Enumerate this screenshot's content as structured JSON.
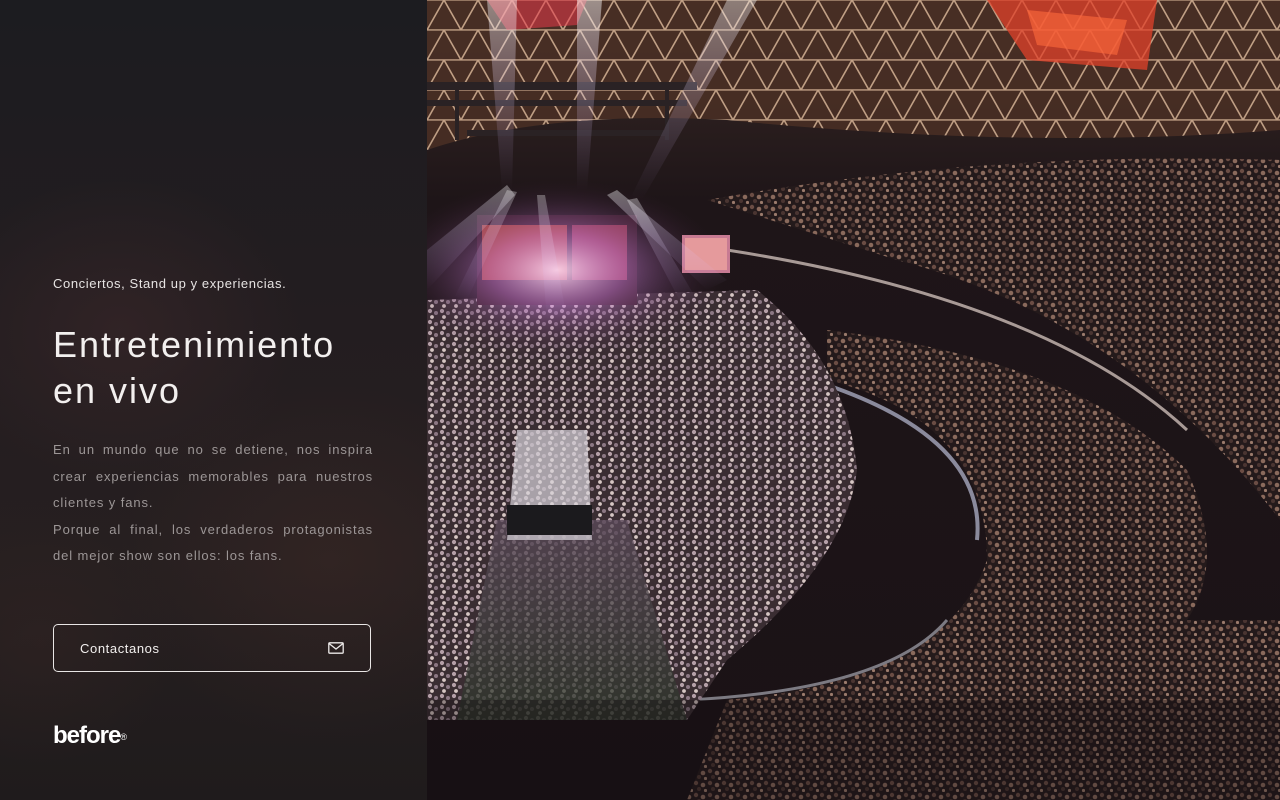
{
  "intro": {
    "tagline": "Conciertos, Stand up y experiencias.",
    "headline_line1": "Entretenimiento",
    "headline_line2": "en vivo",
    "paragraph1": "En un mundo que no se detiene, nos inspira crear experiencias memorables para nuestros clientes y fans.",
    "paragraph2": "Porque al final, los verdaderos protagonistas del mejor show son ellos: los fans."
  },
  "contact_button": {
    "label": "Contactanos",
    "icon": "mail-icon"
  },
  "brand": {
    "logo_text": "before",
    "registered_mark": "®"
  },
  "hero_image": {
    "subject": "concert-arena-crowd-photo"
  },
  "colors": {
    "panel_background": "#1f1b1c",
    "text_primary": "#f2efee",
    "text_muted": "#9c9696",
    "button_border": "#e9e6e5"
  }
}
